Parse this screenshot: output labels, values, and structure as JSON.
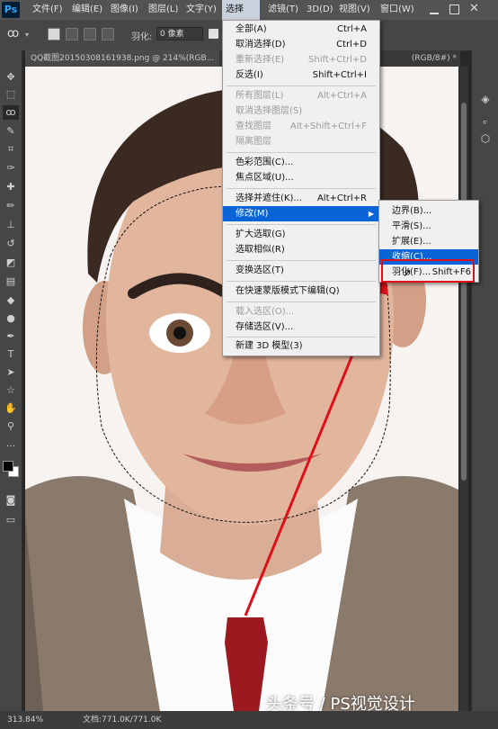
{
  "app": {
    "logo": "Ps"
  },
  "menubar": {
    "items": [
      "文件(F)",
      "编辑(E)",
      "图像(I)",
      "图层(L)",
      "文字(Y)",
      "选择(S)",
      "滤镜(T)",
      "3D(D)",
      "视图(V)",
      "窗口(W)"
    ],
    "active_index": 5
  },
  "options": {
    "feather_label": "羽化:",
    "feather_value": "0 像素"
  },
  "document": {
    "tab_title": "QQ截图20150308161938.png @ 214%(RGB...",
    "tab_tail": "(RGB/8#) *"
  },
  "select_menu": {
    "items": [
      {
        "label": "全部(A)",
        "shortcut": "Ctrl+A",
        "disabled": false
      },
      {
        "label": "取消选择(D)",
        "shortcut": "Ctrl+D",
        "disabled": false
      },
      {
        "label": "重新选择(E)",
        "shortcut": "Shift+Ctrl+D",
        "disabled": true
      },
      {
        "label": "反选(I)",
        "shortcut": "Shift+Ctrl+I",
        "disabled": false
      },
      {
        "label": "所有图层(L)",
        "shortcut": "Alt+Ctrl+A",
        "disabled": true
      },
      {
        "label": "取消选择图层(S)",
        "shortcut": "",
        "disabled": true
      },
      {
        "label": "查找图层",
        "shortcut": "Alt+Shift+Ctrl+F",
        "disabled": true
      },
      {
        "label": "隔离图层",
        "shortcut": "",
        "disabled": true
      },
      {
        "label": "色彩范围(C)...",
        "shortcut": "",
        "disabled": false
      },
      {
        "label": "焦点区域(U)...",
        "shortcut": "",
        "disabled": false
      },
      {
        "label": "选择并遮住(K)...",
        "shortcut": "Alt+Ctrl+R",
        "disabled": false
      },
      {
        "label": "修改(M)",
        "shortcut": "",
        "disabled": false
      },
      {
        "label": "扩大选取(G)",
        "shortcut": "",
        "disabled": false
      },
      {
        "label": "选取相似(R)",
        "shortcut": "",
        "disabled": false
      },
      {
        "label": "变换选区(T)",
        "shortcut": "",
        "disabled": false
      },
      {
        "label": "在快速蒙版模式下编辑(Q)",
        "shortcut": "",
        "disabled": false
      },
      {
        "label": "载入选区(O)...",
        "shortcut": "",
        "disabled": true
      },
      {
        "label": "存储选区(V)...",
        "shortcut": "",
        "disabled": false
      },
      {
        "label": "新建 3D 模型(3)",
        "shortcut": "",
        "disabled": false
      }
    ]
  },
  "modify_submenu": {
    "items": [
      {
        "label": "边界(B)...",
        "shortcut": ""
      },
      {
        "label": "平滑(S)...",
        "shortcut": ""
      },
      {
        "label": "扩展(E)...",
        "shortcut": ""
      },
      {
        "label": "收缩(C)...",
        "shortcut": ""
      },
      {
        "label": "羽化(F)...",
        "shortcut": "Shift+F6"
      }
    ]
  },
  "status": {
    "zoom": "313.84%",
    "doc_info": "文档:771.0K/771.0K"
  },
  "watermark": "头条号 / PS视觉设计",
  "colors": {
    "highlight": "#0a64d8",
    "annotation": "#e0101a"
  }
}
